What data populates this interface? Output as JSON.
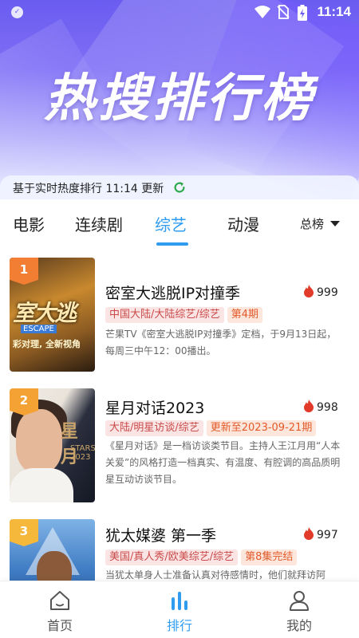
{
  "status_bar": {
    "time": "11:14"
  },
  "hero": {
    "title": "热搜排行榜"
  },
  "update_bar": {
    "text": "基于实时热度排行 11:14 更新"
  },
  "tabs": [
    {
      "label": "电影",
      "active": false
    },
    {
      "label": "连续剧",
      "active": false
    },
    {
      "label": "综艺",
      "active": true
    },
    {
      "label": "动漫",
      "active": false
    }
  ],
  "rank_selector": {
    "label": "总榜"
  },
  "accent_color": "#2f9cf0",
  "items": [
    {
      "rank": "1",
      "poster_text": "室大逃",
      "poster_tag": "ESCAPE",
      "poster_sub": "彩对理, 全新视角",
      "title": "密室大逃脱IP对撞季",
      "heat": "999",
      "tags": "中国大陆/大陆综艺/综艺",
      "episode": "第4期",
      "desc": "芒果TV《密室大逃脱IP对撞季》定档，于9月13日起，每周三中午12：00播出。"
    },
    {
      "rank": "2",
      "poster_text": "星月",
      "poster_sub": "STARS 2023",
      "title": "星月对话2023",
      "heat": "998",
      "tags": "大陆/明星访谈/综艺",
      "episode": "更新至2023-09-21期",
      "desc": "《星月对话》是一档访谈类节目。主持人王江月用“人本关爱”的风格打造一档真实、有温度、有腔调的高品质明星互动访谈节目。"
    },
    {
      "rank": "3",
      "title": "犹太媒婆 第一季",
      "heat": "997",
      "tags": "美国/真人秀/欧美综艺/综艺",
      "episode": "第8集完结",
      "desc": "当犹太单身人士准备认真对待感情时，他们就拜访阿"
    }
  ],
  "bottom_nav": [
    {
      "label": "首页",
      "icon": "home-icon",
      "active": false
    },
    {
      "label": "排行",
      "icon": "ranking-icon",
      "active": true
    },
    {
      "label": "我的",
      "icon": "profile-icon",
      "active": false
    }
  ]
}
